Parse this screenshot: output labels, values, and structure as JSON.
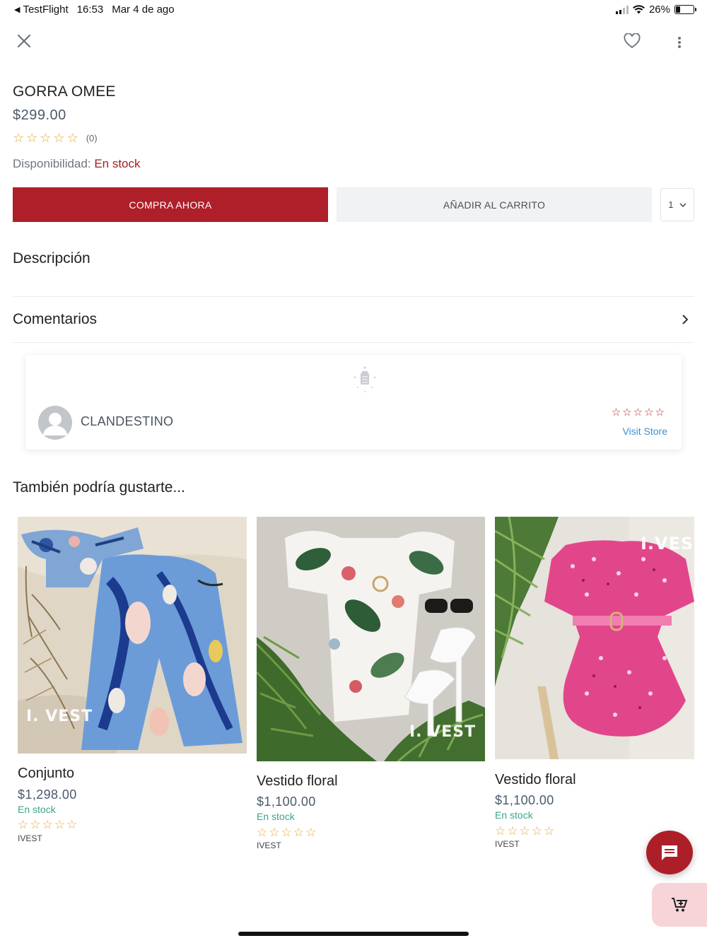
{
  "status_bar": {
    "back_app": "TestFlight",
    "time": "16:53",
    "date": "Mar 4 de ago",
    "battery": "26%",
    "battery_level": 0.26
  },
  "top_bar": {
    "close_icon": "close-icon",
    "favorite_icon": "heart-icon",
    "more_icon": "more-vertical-icon"
  },
  "product": {
    "title": "GORRA OMEE",
    "price": "$299.00",
    "rating_count": "(0)",
    "rating_value": 0,
    "availability_label": "Disponibilidad:",
    "availability_value": "En stock"
  },
  "actions": {
    "buy_now": "COMPRA AHORA",
    "add_to_cart": "AÑADIR AL CARRITO",
    "quantity": "1"
  },
  "sections": {
    "description": "Descripción",
    "comments": "Comentarios"
  },
  "store": {
    "name": "CLANDESTINO",
    "visit": "Visit Store",
    "rating": 0
  },
  "recommendations": {
    "heading": "También podría gustarte...",
    "items": [
      {
        "name": "Conjunto",
        "price": "$1,298.00",
        "stock": "En stock",
        "vendor": "IVEST",
        "watermark": "I. VEST"
      },
      {
        "name": "Vestido floral",
        "price": "$1,100.00",
        "stock": "En stock",
        "vendor": "IVEST",
        "watermark": "I. VEST"
      },
      {
        "name": "Vestido floral",
        "price": "$1,100.00",
        "stock": "En stock",
        "vendor": "IVEST",
        "watermark": "I.VEST"
      }
    ]
  },
  "colors": {
    "brand_red": "#ae1f2a",
    "stock_green": "#3ea38a",
    "star_gold": "#e4a83a",
    "link_blue": "#3a8fd6"
  },
  "fabs": {
    "chat_icon": "chat-bubble-icon",
    "cart_icon": "add-to-cart-icon"
  }
}
